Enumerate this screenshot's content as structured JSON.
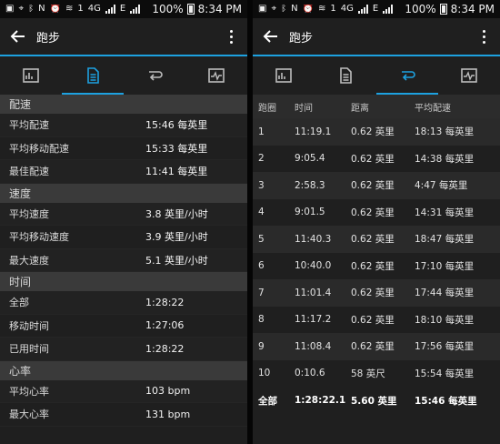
{
  "status": {
    "battery": "100%",
    "time": "8:34 PM",
    "network": "4G",
    "carrier_mark": "E",
    "signal_slot": "1",
    "notify_letter": "N"
  },
  "app": {
    "title": "跑步"
  },
  "stats": {
    "sections": [
      {
        "title": "配速",
        "rows": [
          {
            "label": "平均配速",
            "value": "15:46 每英里"
          },
          {
            "label": "平均移动配速",
            "value": "15:33 每英里"
          },
          {
            "label": "最佳配速",
            "value": "11:41 每英里"
          }
        ]
      },
      {
        "title": "速度",
        "rows": [
          {
            "label": "平均速度",
            "value": "3.8 英里/小时"
          },
          {
            "label": "平均移动速度",
            "value": "3.9 英里/小时"
          },
          {
            "label": "最大速度",
            "value": "5.1 英里/小时"
          }
        ]
      },
      {
        "title": "时间",
        "rows": [
          {
            "label": "全部",
            "value": "1:28:22"
          },
          {
            "label": "移动时间",
            "value": "1:27:06"
          },
          {
            "label": "已用时间",
            "value": "1:28:22"
          }
        ]
      },
      {
        "title": "心率",
        "rows": [
          {
            "label": "平均心率",
            "value": "103 bpm"
          },
          {
            "label": "最大心率",
            "value": "131 bpm"
          }
        ]
      }
    ]
  },
  "laps": {
    "headers": [
      "跑圈",
      "时间",
      "距离",
      "平均配速"
    ],
    "rows": [
      [
        "1",
        "11:19.1",
        "0.62 英里",
        "18:13 每英里"
      ],
      [
        "2",
        "9:05.4",
        "0.62 英里",
        "14:38 每英里"
      ],
      [
        "3",
        "2:58.3",
        "0.62 英里",
        "4:47 每英里"
      ],
      [
        "4",
        "9:01.5",
        "0.62 英里",
        "14:31 每英里"
      ],
      [
        "5",
        "11:40.3",
        "0.62 英里",
        "18:47 每英里"
      ],
      [
        "6",
        "10:40.0",
        "0.62 英里",
        "17:10 每英里"
      ],
      [
        "7",
        "11:01.4",
        "0.62 英里",
        "17:44 每英里"
      ],
      [
        "8",
        "11:17.2",
        "0.62 英里",
        "18:10 每英里"
      ],
      [
        "9",
        "11:08.4",
        "0.62 英里",
        "17:56 每英里"
      ],
      [
        "10",
        "0:10.6",
        "58 英尺",
        "15:54 每英里"
      ]
    ],
    "total": [
      "全部",
      "1:28:22.1",
      "5.60 英里",
      "15:46 每英里"
    ]
  },
  "tabs": [
    {
      "icon": "summary-chart-icon"
    },
    {
      "icon": "stats-list-icon"
    },
    {
      "icon": "laps-loop-icon"
    },
    {
      "icon": "graph-icon"
    }
  ],
  "colors": {
    "accent": "#1da1e0",
    "background": "#1f1f1f",
    "section": "#3a3a3a"
  }
}
